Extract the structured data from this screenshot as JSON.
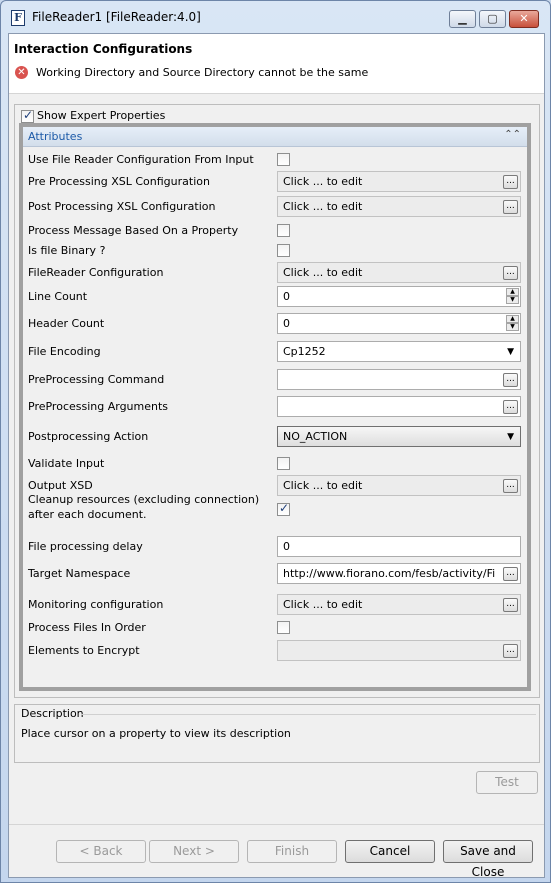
{
  "window": {
    "icon_letter": "F",
    "title": "FileReader1 [FileReader:4.0]"
  },
  "header": {
    "title": "Interaction Configurations",
    "error": "Working Directory and Source Directory cannot be the same"
  },
  "expert": {
    "label": "Show Expert Properties",
    "checked": true
  },
  "attributes": {
    "title": "Attributes",
    "rows": [
      {
        "label": "Use File Reader Configuration From Input",
        "type": "checkbox",
        "checked": false
      },
      {
        "label": "Pre Processing XSL Configuration",
        "type": "edit",
        "value": "Click ... to edit"
      },
      {
        "label": "Post Processing XSL Configuration",
        "type": "edit",
        "value": "Click ... to edit"
      },
      {
        "label": "Process Message Based On a Property",
        "type": "checkbox",
        "checked": false
      },
      {
        "label": "Is file Binary ?",
        "type": "checkbox",
        "checked": false
      },
      {
        "label": "FileReader Configuration",
        "type": "edit",
        "value": "Click ... to edit"
      },
      {
        "label": "Line Count",
        "type": "spinner",
        "value": "0"
      },
      {
        "label": "Header Count",
        "type": "spinner",
        "value": "0"
      },
      {
        "label": "File Encoding",
        "type": "dropdown",
        "value": "Cp1252"
      },
      {
        "label": "PreProcessing Command",
        "type": "text-ellipsis",
        "value": ""
      },
      {
        "label": "PreProcessing Arguments",
        "type": "text-ellipsis",
        "value": ""
      },
      {
        "label": "Postprocessing Action",
        "type": "combo",
        "value": "NO_ACTION"
      },
      {
        "label": "Validate Input",
        "type": "checkbox",
        "checked": false
      },
      {
        "label": "Output XSD",
        "type": "edit",
        "value": "Click ... to edit"
      },
      {
        "label": "Cleanup resources (excluding connection)",
        "label2": "after each document.",
        "type": "checkbox",
        "checked": true
      },
      {
        "label": "File processing delay",
        "type": "text",
        "value": "0"
      },
      {
        "label": "Target Namespace",
        "type": "text-ellipsis",
        "value": "http://www.fiorano.com/fesb/activity/Fi"
      },
      {
        "label": "Monitoring configuration",
        "type": "edit",
        "value": "Click ... to edit"
      },
      {
        "label": "Process Files In Order",
        "type": "checkbox",
        "checked": false
      },
      {
        "label": "Elements to Encrypt",
        "type": "edit",
        "value": ""
      }
    ]
  },
  "description": {
    "title": "Description",
    "text": "Place cursor on a property to view its description"
  },
  "buttons": {
    "test": "Test",
    "back": "< Back",
    "next": "Next >",
    "finish": "Finish",
    "cancel": "Cancel",
    "save_close": "Save and Close"
  },
  "icons": {
    "error": "error-icon",
    "collapse": "collapse-icon",
    "ellipsis": "ellipsis-icon"
  }
}
